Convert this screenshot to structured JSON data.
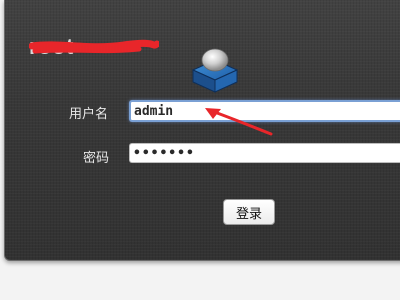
{
  "brand": {
    "name_partial": "root",
    "logo_icon": "server-box-icon"
  },
  "form": {
    "username_label": "用户名",
    "username_value": "admin",
    "password_label": "密码",
    "password_value": "•••••••",
    "submit_label": "登录"
  },
  "annotation": {
    "arrow_color": "#e8262a"
  },
  "colors": {
    "panel_background": "#3a3a3a",
    "focus_border": "#7aa0d4",
    "redaction": "#e8262a"
  }
}
